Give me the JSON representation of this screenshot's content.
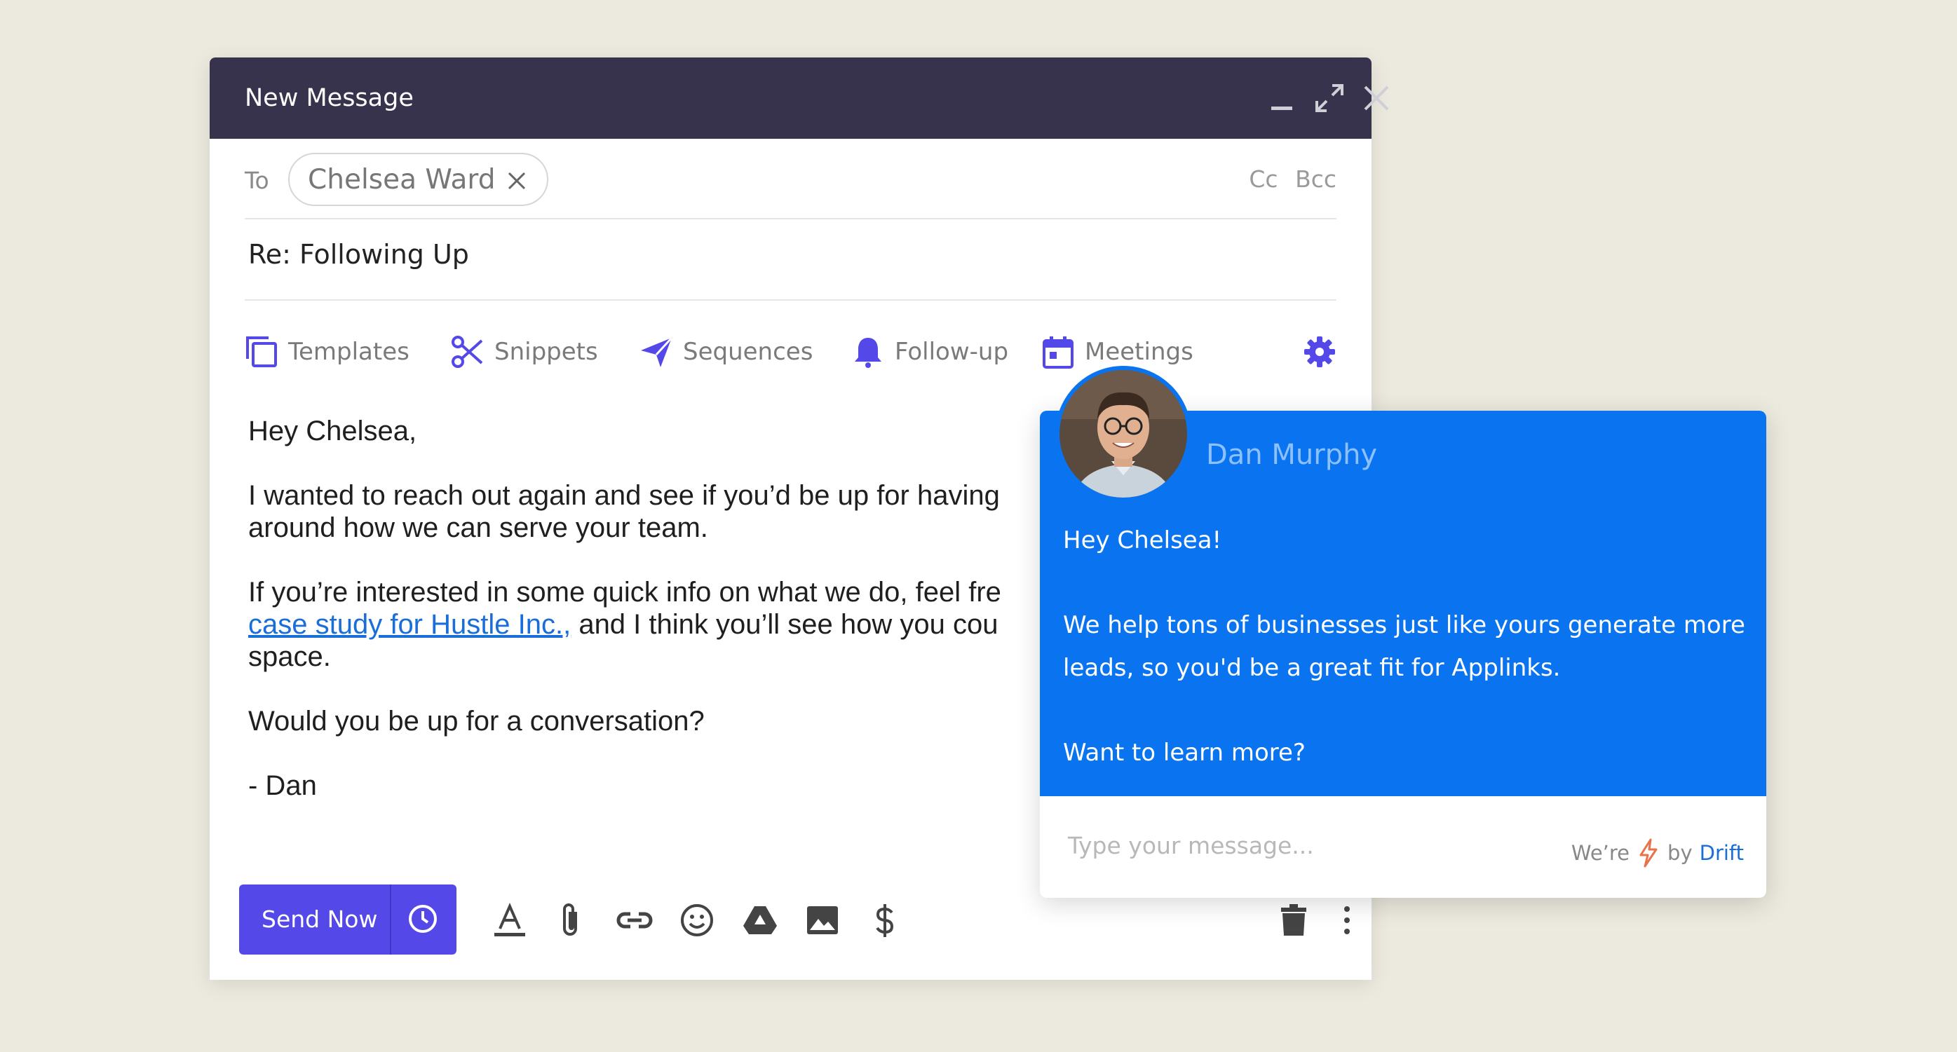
{
  "window": {
    "title": "New Message",
    "controls": [
      "minimize-icon",
      "expand-icon",
      "close-icon"
    ]
  },
  "to_row": {
    "label": "To",
    "recipient": "Chelsea Ward",
    "cc": "Cc",
    "bcc": "Bcc"
  },
  "subject": "Re: Following Up",
  "toolbar": {
    "items": [
      {
        "label": "Templates",
        "icon": "templates-icon"
      },
      {
        "label": "Snippets",
        "icon": "scissors-icon"
      },
      {
        "label": "Sequences",
        "icon": "send-plane-icon"
      },
      {
        "label": "Follow-up",
        "icon": "bell-icon"
      },
      {
        "label": "Meetings",
        "icon": "calendar-icon"
      }
    ],
    "settings_icon": "gear-icon",
    "accent": "#5548e8"
  },
  "body": {
    "greeting": "Hey Chelsea,",
    "p1": "I wanted to reach out again and see if you’d be up for having",
    "p1b": "around how we can serve your team.",
    "p2": "If you’re interested in some quick info on what we do, feel fre",
    "link": "case study for Hustle Inc.,",
    "p2b": " and I think you’ll see how you cou",
    "p2c": "space.",
    "p3": "Would you be up for a conversation?",
    "signature": "- Dan"
  },
  "footer": {
    "send_label": "Send Now",
    "icons": [
      "text-format-icon",
      "paperclip-icon",
      "link-icon",
      "emoji-icon",
      "drive-icon",
      "image-icon",
      "dollar-icon",
      "trash-icon",
      "more-vertical-icon"
    ]
  },
  "chat": {
    "agent_name": "Dan Murphy",
    "greeting": "Hey Chelsea!",
    "message_line1": "We help tons of businesses just like yours generate more",
    "message_line2": "leads, so you'd be a great fit for Applinks.",
    "question": "Want to learn more?",
    "input_placeholder": "Type your message...",
    "powered_prefix": "We’re",
    "powered_by": "by",
    "brand": "Drift",
    "panel_color": "#0a74f0"
  }
}
